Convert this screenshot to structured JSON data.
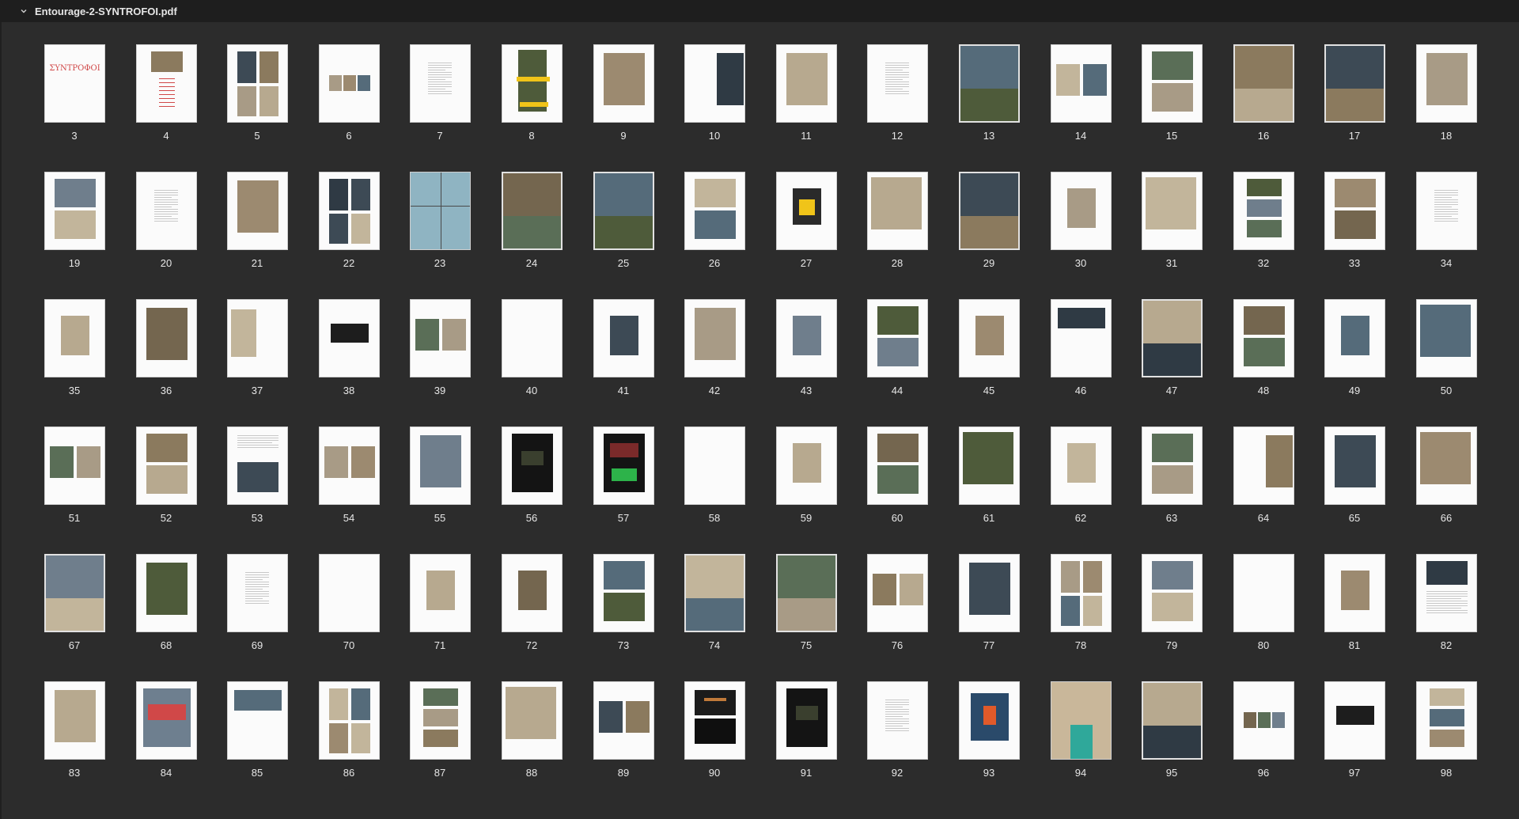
{
  "window": {
    "title": "Entourage-2-SYNTROFOI.pdf",
    "collapse_icon": "chevron-down-icon"
  },
  "cover_title": "ΣΥΝΤΡΟΦΟΙ",
  "colors": {
    "photo_palette": [
      "#5a6e57",
      "#8b7a5e",
      "#3d4a55",
      "#a89b86",
      "#6f7e8c",
      "#4e5b3a",
      "#9c8a70",
      "#2f3a44",
      "#b7a98f",
      "#74664f",
      "#556b7a",
      "#c2b59b"
    ],
    "accent_red": "#d04848",
    "accent_yellow": "#f0c419",
    "accent_green": "#2db34a"
  },
  "pages": [
    {
      "n": "3",
      "k": "cover"
    },
    {
      "n": "4",
      "k": "toc"
    },
    {
      "n": "5",
      "k": "4q"
    },
    {
      "n": "6",
      "k": "strip"
    },
    {
      "n": "7",
      "k": "text"
    },
    {
      "n": "8",
      "k": "yellow"
    },
    {
      "n": "9",
      "k": "p"
    },
    {
      "n": "10",
      "k": "pr"
    },
    {
      "n": "11",
      "k": "p"
    },
    {
      "n": "12",
      "k": "text"
    },
    {
      "n": "13",
      "k": "full",
      "sel": true
    },
    {
      "n": "14",
      "k": "pair"
    },
    {
      "n": "15",
      "k": "two"
    },
    {
      "n": "16",
      "k": "full",
      "sel": true
    },
    {
      "n": "17",
      "k": "full",
      "sel": true
    },
    {
      "n": "18",
      "k": "p"
    },
    {
      "n": "19",
      "k": "two"
    },
    {
      "n": "20",
      "k": "text"
    },
    {
      "n": "21",
      "k": "p"
    },
    {
      "n": "22",
      "k": "4q"
    },
    {
      "n": "23",
      "k": "cross"
    },
    {
      "n": "24",
      "k": "full",
      "sel": true
    },
    {
      "n": "25",
      "k": "full",
      "sel": true
    },
    {
      "n": "26",
      "k": "two"
    },
    {
      "n": "27",
      "k": "yellowman"
    },
    {
      "n": "28",
      "k": "pb"
    },
    {
      "n": "29",
      "k": "full",
      "sel": true
    },
    {
      "n": "30",
      "k": "small"
    },
    {
      "n": "31",
      "k": "pb"
    },
    {
      "n": "32",
      "k": "three"
    },
    {
      "n": "33",
      "k": "two"
    },
    {
      "n": "34",
      "k": "text"
    },
    {
      "n": "35",
      "k": "small"
    },
    {
      "n": "36",
      "k": "p"
    },
    {
      "n": "37",
      "k": "pl"
    },
    {
      "n": "38",
      "k": "tiny"
    },
    {
      "n": "39",
      "k": "pair"
    },
    {
      "n": "40",
      "k": "blank"
    },
    {
      "n": "41",
      "k": "small"
    },
    {
      "n": "42",
      "k": "p"
    },
    {
      "n": "43",
      "k": "small"
    },
    {
      "n": "44",
      "k": "two"
    },
    {
      "n": "45",
      "k": "small"
    },
    {
      "n": "46",
      "k": "top"
    },
    {
      "n": "47",
      "k": "full",
      "sel": true
    },
    {
      "n": "48",
      "k": "two"
    },
    {
      "n": "49",
      "k": "small"
    },
    {
      "n": "50",
      "k": "pb"
    },
    {
      "n": "51",
      "k": "pair"
    },
    {
      "n": "52",
      "k": "two"
    },
    {
      "n": "53",
      "k": "textimg"
    },
    {
      "n": "54",
      "k": "pair"
    },
    {
      "n": "55",
      "k": "p"
    },
    {
      "n": "56",
      "k": "dark"
    },
    {
      "n": "57",
      "k": "green"
    },
    {
      "n": "58",
      "k": "blank"
    },
    {
      "n": "59",
      "k": "small"
    },
    {
      "n": "60",
      "k": "two"
    },
    {
      "n": "61",
      "k": "pb"
    },
    {
      "n": "62",
      "k": "small"
    },
    {
      "n": "63",
      "k": "two"
    },
    {
      "n": "64",
      "k": "pr"
    },
    {
      "n": "65",
      "k": "p"
    },
    {
      "n": "66",
      "k": "pb"
    },
    {
      "n": "67",
      "k": "full",
      "sel": true
    },
    {
      "n": "68",
      "k": "p"
    },
    {
      "n": "69",
      "k": "text"
    },
    {
      "n": "70",
      "k": "blank"
    },
    {
      "n": "71",
      "k": "small"
    },
    {
      "n": "72",
      "k": "small"
    },
    {
      "n": "73",
      "k": "two"
    },
    {
      "n": "74",
      "k": "full",
      "sel": true
    },
    {
      "n": "75",
      "k": "full",
      "sel": true
    },
    {
      "n": "76",
      "k": "pair"
    },
    {
      "n": "77",
      "k": "p"
    },
    {
      "n": "78",
      "k": "4q"
    },
    {
      "n": "79",
      "k": "two"
    },
    {
      "n": "80",
      "k": "blank"
    },
    {
      "n": "81",
      "k": "small"
    },
    {
      "n": "82",
      "k": "imgtext"
    },
    {
      "n": "83",
      "k": "p"
    },
    {
      "n": "84",
      "k": "red"
    },
    {
      "n": "85",
      "k": "top"
    },
    {
      "n": "86",
      "k": "4q"
    },
    {
      "n": "87",
      "k": "three"
    },
    {
      "n": "88",
      "k": "pb"
    },
    {
      "n": "89",
      "k": "pair"
    },
    {
      "n": "90",
      "k": "dark2"
    },
    {
      "n": "91",
      "k": "dark"
    },
    {
      "n": "92",
      "k": "text"
    },
    {
      "n": "93",
      "k": "cone"
    },
    {
      "n": "94",
      "k": "teal"
    },
    {
      "n": "95",
      "k": "full",
      "sel": true
    },
    {
      "n": "96",
      "k": "strip"
    },
    {
      "n": "97",
      "k": "tiny"
    },
    {
      "n": "98",
      "k": "three"
    }
  ]
}
